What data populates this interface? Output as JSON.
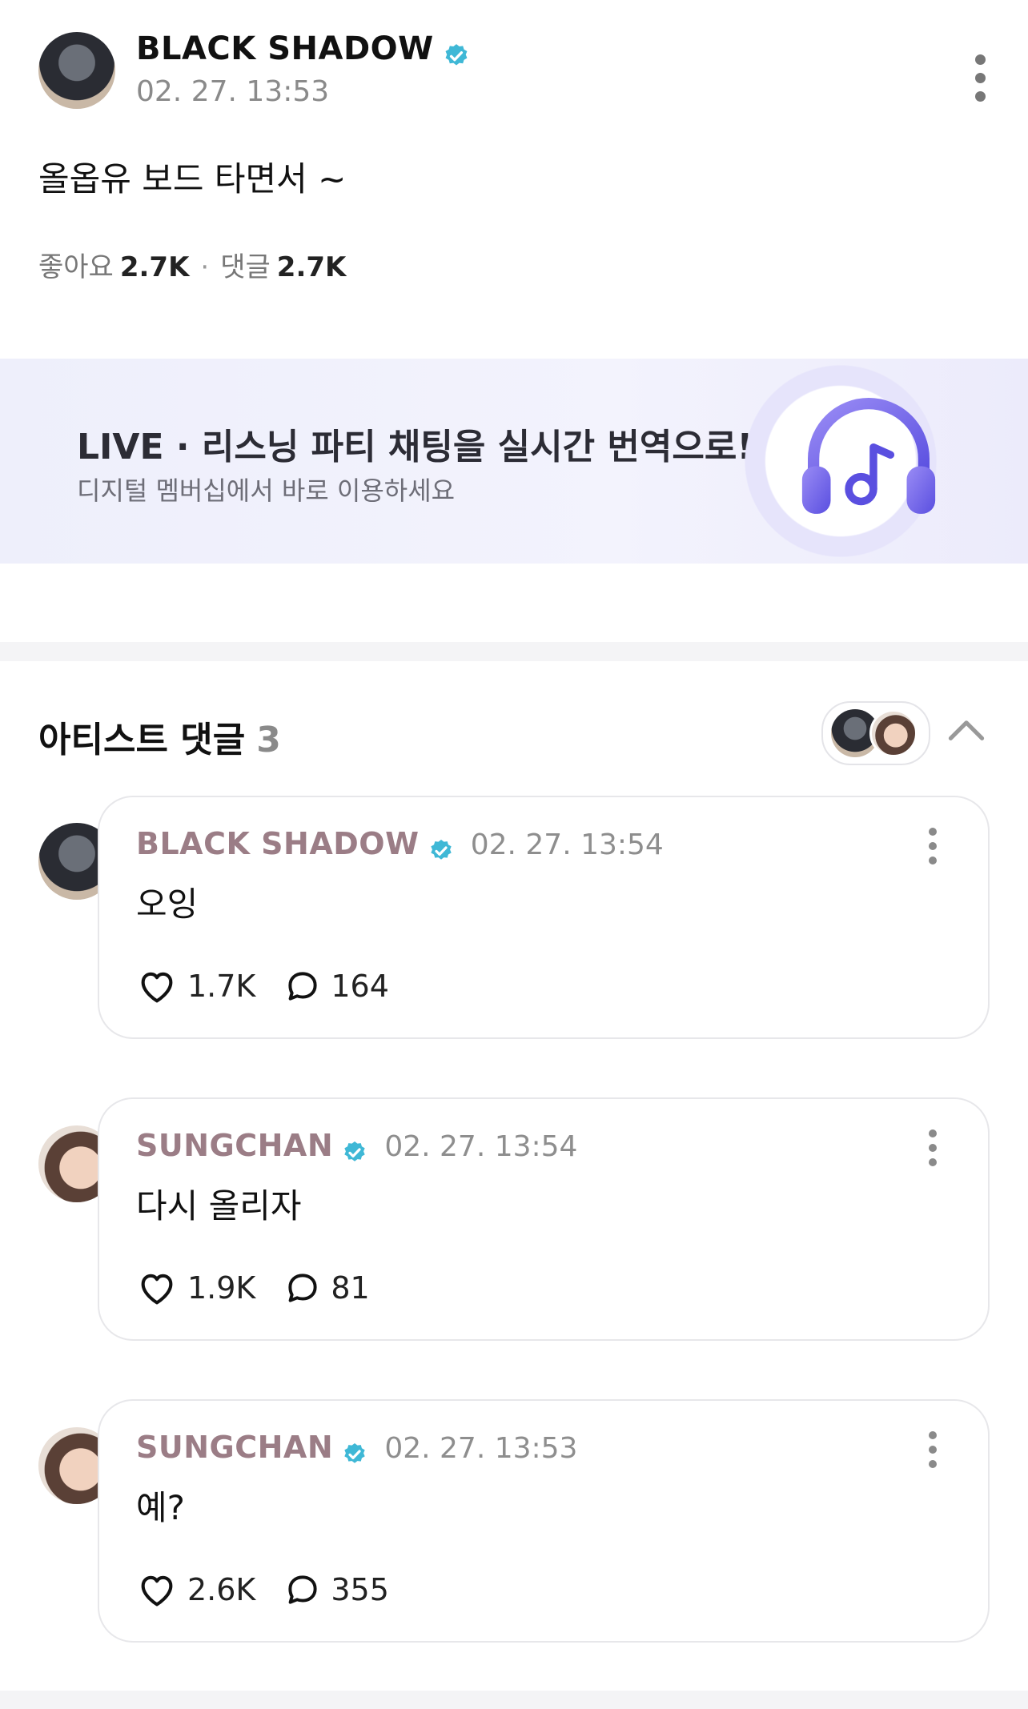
{
  "post": {
    "author": "BLACK SHADOW",
    "timestamp": "02. 27. 13:53",
    "body": "올옵유 보드 타면서 ~",
    "likes_label": "좋아요",
    "likes_count": "2.7K",
    "comments_label": "댓글",
    "comments_count": "2.7K"
  },
  "banner": {
    "title": "LIVE · 리스닝 파티 채팅을 실시간 번역으로!",
    "subtitle": "디지털 멤버십에서 바로 이용하세요",
    "icon": "headphones-music-icon"
  },
  "artist_comments": {
    "title": "아티스트 댓글",
    "count": "3",
    "items": [
      {
        "author": "BLACK SHADOW",
        "timestamp": "02. 27. 13:54",
        "body": "오잉",
        "likes": "1.7K",
        "replies": "164"
      },
      {
        "author": "SUNGCHAN",
        "timestamp": "02. 27. 13:54",
        "body": "다시 올리자",
        "likes": "1.9K",
        "replies": "81"
      },
      {
        "author": "SUNGCHAN",
        "timestamp": "02. 27. 13:53",
        "body": "예?",
        "likes": "2.6K",
        "replies": "355"
      }
    ]
  },
  "colors": {
    "verified": "#3fb8d6",
    "comment_author": "#9b7d86",
    "banner_accent": "#7b6cf0"
  }
}
